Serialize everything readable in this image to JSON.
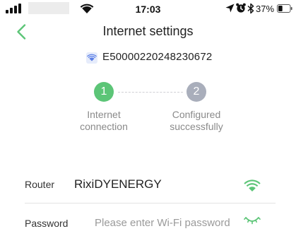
{
  "status_bar": {
    "time": "17:03",
    "battery_percent": "37%",
    "battery_level": 0.37,
    "icons": [
      "signal-icon",
      "wifi-icon",
      "location-arrow-icon",
      "alarm-icon",
      "bluetooth-icon",
      "battery-icon"
    ]
  },
  "header": {
    "title": "Internet settings",
    "back_icon": "chevron-left-icon"
  },
  "device": {
    "id": "E50000220248230672",
    "icon": "wifi-device-icon"
  },
  "steps": [
    {
      "number": "1",
      "label_line1": "Internet",
      "label_line2": "connection",
      "state": "active"
    },
    {
      "number": "2",
      "label_line1": "Configured",
      "label_line2": "successfully",
      "state": "inactive"
    }
  ],
  "form": {
    "router_label": "Router",
    "router_value": "RixiDYENERGY",
    "password_label": "Password",
    "password_placeholder": "Please enter Wi-Fi password",
    "password_value": ""
  },
  "colors": {
    "accent": "#5cc577",
    "inactive_step": "#a9aebb",
    "device_icon": "#5b7fe6"
  }
}
